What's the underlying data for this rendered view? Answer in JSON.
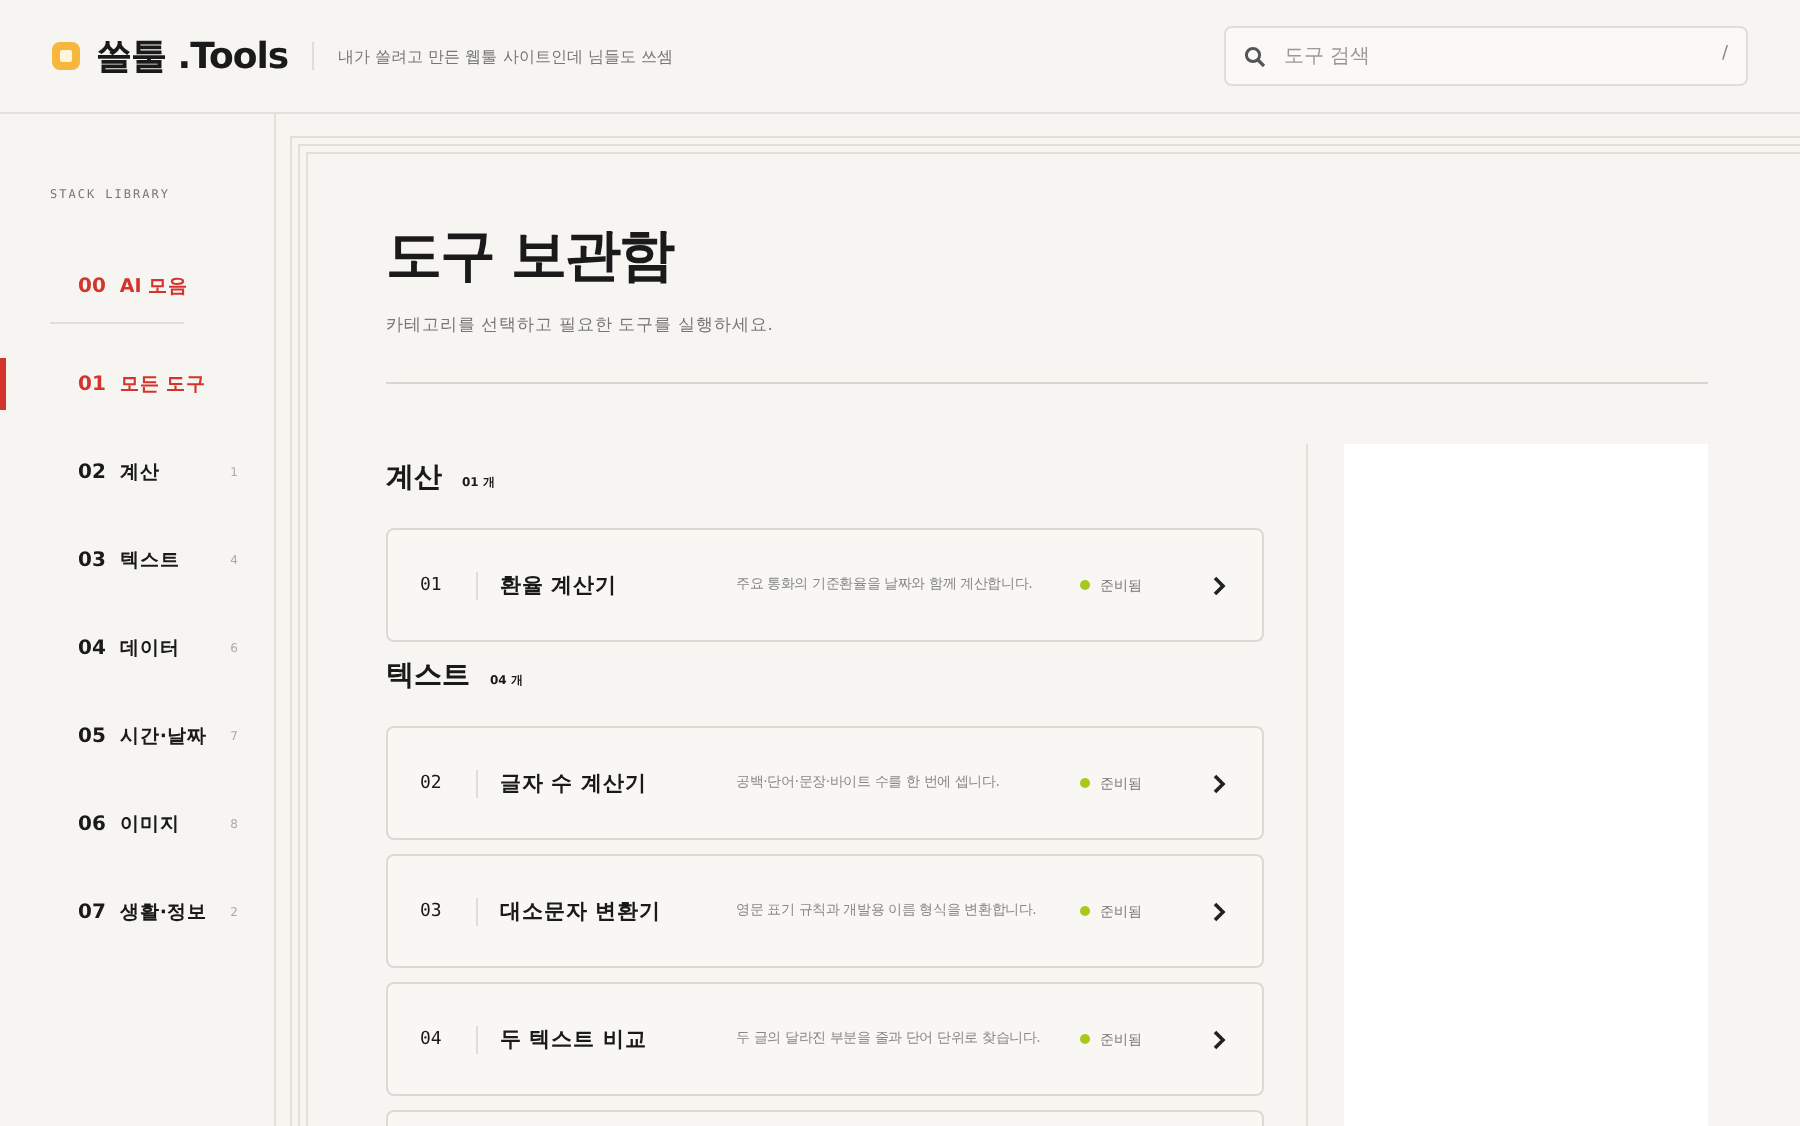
{
  "header": {
    "logo_text": "쓸툴 .Tools",
    "tagline": "내가 쓸려고 만든 웹툴 사이트인데 님들도 쓰셈",
    "search": {
      "placeholder": "도구 검색",
      "shortcut": "/"
    }
  },
  "sidebar": {
    "heading": "STACK LIBRARY",
    "items": [
      {
        "kind": "featured",
        "number": "00",
        "label": "AI 모음",
        "selected": false
      },
      {
        "kind": "category",
        "number": "01",
        "label": "모든 도구",
        "selected": true
      },
      {
        "kind": "category",
        "number": "02",
        "label": "계산",
        "count": "1",
        "selected": false
      },
      {
        "kind": "category",
        "number": "03",
        "label": "텍스트",
        "count": "4",
        "selected": false
      },
      {
        "kind": "category",
        "number": "04",
        "label": "데이터",
        "count": "6",
        "selected": false
      },
      {
        "kind": "category",
        "number": "05",
        "label": "시간·날짜",
        "count": "7",
        "selected": false
      },
      {
        "kind": "category",
        "number": "06",
        "label": "이미지",
        "count": "8",
        "selected": false
      },
      {
        "kind": "category",
        "number": "07",
        "label": "생활·정보",
        "count": "2",
        "selected": false
      }
    ]
  },
  "page": {
    "title": "도구 보관함",
    "subtitle": "카테고리를 선택하고 필요한 도구를 실행하세요."
  },
  "sections": [
    {
      "title": "계산",
      "count": "01 개",
      "tools": [
        {
          "number": "01",
          "name": "환율 계산기",
          "description": "주요 통화의 기준환율을 날짜와 함께 계산합니다.",
          "status": "준비됨",
          "color": "#a8c81e"
        }
      ]
    },
    {
      "title": "텍스트",
      "count": "04 개",
      "tools": [
        {
          "number": "02",
          "name": "글자 수 계산기",
          "description": "공백·단어·문장·바이트 수를 한 번에 셉니다.",
          "status": "준비됨",
          "color": "#a8c81e"
        },
        {
          "number": "03",
          "name": "대소문자 변환기",
          "description": "영문 표기 규칙과 개발용 이름 형식을 변환합니다.",
          "status": "준비됨",
          "color": "#a8c81e"
        },
        {
          "number": "04",
          "name": "두 텍스트 비교",
          "description": "두 글의 달라진 부분을 줄과 단어 단위로 찾습니다.",
          "status": "준비됨",
          "color": "#a8c81e"
        }
      ]
    }
  ]
}
